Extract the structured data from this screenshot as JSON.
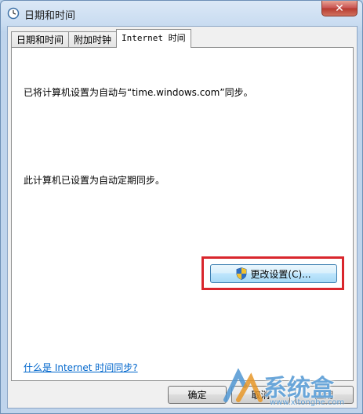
{
  "window": {
    "title": "日期和时间",
    "close_label": "✕"
  },
  "tabs": [
    {
      "label": "日期和时间",
      "active": false
    },
    {
      "label": "附加时钟",
      "active": false
    },
    {
      "label": "Internet 时间",
      "active": true
    }
  ],
  "panel": {
    "sync_server_text": "已将计算机设置为自动与“time.windows.com”同步。",
    "auto_sync_text": "此计算机已设置为自动定期同步。",
    "change_settings_label": "更改设置(C)...",
    "help_link": "什么是 Internet 时间同步?"
  },
  "footer": {
    "ok_label": "确定",
    "cancel_label": "取消",
    "apply_label": "应用"
  },
  "watermark": {
    "text": "系统盒",
    "url": "www.xitonghe.com"
  },
  "colors": {
    "highlight_border": "#d9262c",
    "link": "#0066cc"
  }
}
